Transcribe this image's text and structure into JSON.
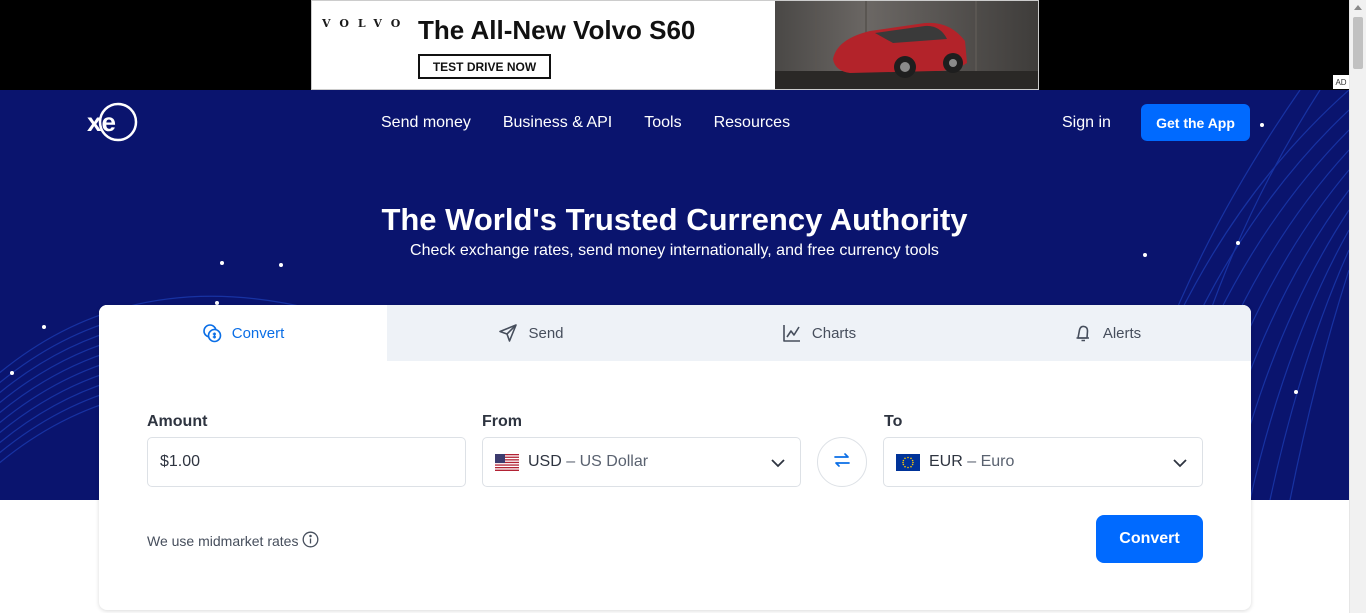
{
  "ad": {
    "brand": "VOLVO",
    "headline": "The All-New Volvo S60",
    "cta": "TEST DRIVE NOW",
    "badge": "AD"
  },
  "header": {
    "logo_text": "xe",
    "nav": [
      "Send money",
      "Business & API",
      "Tools",
      "Resources"
    ],
    "sign_in": "Sign in",
    "get_app": "Get the App"
  },
  "hero": {
    "title": "The World's Trusted Currency Authority",
    "subtitle": "Check exchange rates, send money internationally, and free currency tools"
  },
  "tabs": [
    {
      "label": "Convert",
      "icon": "coins-icon",
      "active": true
    },
    {
      "label": "Send",
      "icon": "paper-plane-icon",
      "active": false
    },
    {
      "label": "Charts",
      "icon": "line-chart-icon",
      "active": false
    },
    {
      "label": "Alerts",
      "icon": "bell-icon",
      "active": false
    }
  ],
  "converter": {
    "amount_label": "Amount",
    "amount_value": "$1.00",
    "from_label": "From",
    "from_code": "USD",
    "from_name": "US Dollar",
    "to_label": "To",
    "to_code": "EUR",
    "to_name": "Euro",
    "separator": "–",
    "note": "We use midmarket rates",
    "convert_button": "Convert"
  },
  "colors": {
    "hero_bg": "#0a146e",
    "accent": "#006aff",
    "active_tab_text": "#0a6ee6"
  }
}
